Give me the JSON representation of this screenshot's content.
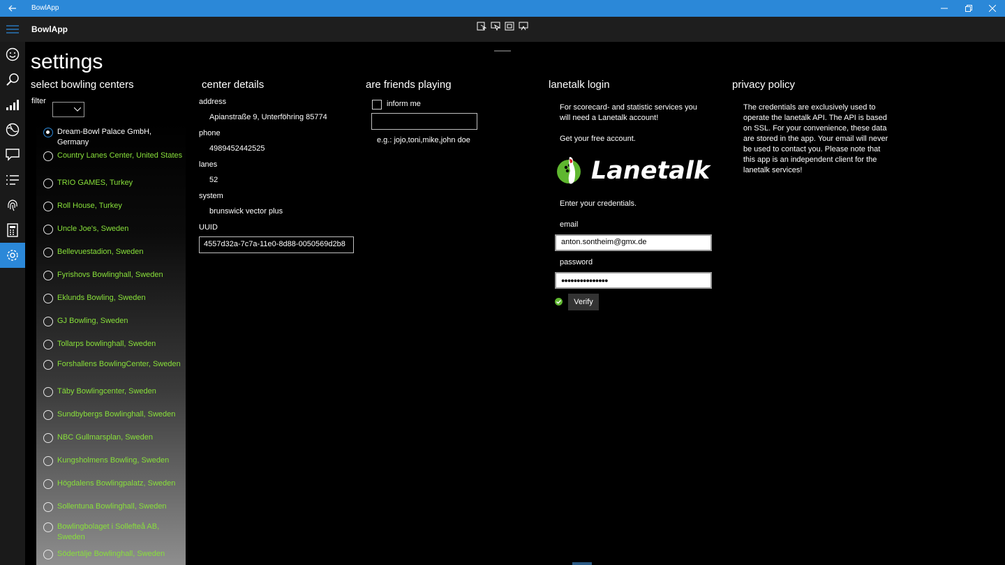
{
  "window": {
    "title": "BowlApp",
    "controls": [
      "minimize",
      "restore",
      "close"
    ]
  },
  "appbar": {
    "app_name": "BowlApp",
    "tools": [
      "tool-1-icon",
      "tool-2-icon",
      "tool-3-icon",
      "tool-4-icon"
    ]
  },
  "sidebar": {
    "items": [
      {
        "icon": "hamburger-menu-icon"
      },
      {
        "icon": "smiley-icon"
      },
      {
        "icon": "search-icon"
      },
      {
        "icon": "statistics-icon"
      },
      {
        "icon": "globe-icon"
      },
      {
        "icon": "chat-icon"
      },
      {
        "icon": "list-icon"
      },
      {
        "icon": "fingerprint-icon"
      },
      {
        "icon": "calculator-icon"
      },
      {
        "icon": "settings-icon",
        "active": true
      }
    ]
  },
  "page": {
    "heading": "settings"
  },
  "centers": {
    "title": "select bowling centers",
    "filter_label": "filter",
    "items": [
      {
        "label": "Dream-Bowl Palace GmbH, Germany",
        "selected": true
      },
      {
        "label": "Country Lanes Center, United States"
      },
      {
        "label": "TRIO GAMES, Turkey"
      },
      {
        "label": "Roll House, Turkey"
      },
      {
        "label": "Uncle Joe's, Sweden"
      },
      {
        "label": "Bellevuestadion, Sweden"
      },
      {
        "label": "Fyrishovs Bowlinghall, Sweden"
      },
      {
        "label": "Eklunds Bowling, Sweden"
      },
      {
        "label": "GJ Bowling, Sweden"
      },
      {
        "label": "Tollarps bowlinghall, Sweden"
      },
      {
        "label": "Forshallens BowlingCenter, Sweden"
      },
      {
        "label": "Täby Bowlingcenter, Sweden"
      },
      {
        "label": "Sundbybergs Bowlinghall, Sweden"
      },
      {
        "label": "NBC Gullmarsplan, Sweden"
      },
      {
        "label": "Kungsholmens Bowling, Sweden"
      },
      {
        "label": "Högdalens Bowlingpalatz, Sweden"
      },
      {
        "label": "Sollentuna Bowlinghall, Sweden"
      },
      {
        "label": "Bowlingbolaget i Sollefteå AB, Sweden"
      },
      {
        "label": "Södertälje Bowlinghall, Sweden"
      }
    ]
  },
  "details": {
    "title": "center details",
    "address_label": "address",
    "address": "Apianstraße 9, Unterföhring 85774",
    "phone_label": "phone",
    "phone": "4989452442525",
    "lanes_label": "lanes",
    "lanes": "52",
    "system_label": "system",
    "system": "brunswick vector plus",
    "uuid_label": "UUID",
    "uuid": "4557d32a-7c7a-11e0-8d88-0050569d2b8"
  },
  "friends": {
    "title": "are friends playing",
    "inform_label": "inform me",
    "inform_checked": false,
    "input_value": "",
    "hint": "e.g.: jojo,toni,mike,john doe"
  },
  "lanetalk": {
    "title": "lanetalk login",
    "intro": "For scorecard- and statistic services you will need a Lanetalk account!",
    "free_account": "Get your free account.",
    "logo_text": "Lanetalk",
    "credentials_prompt": "Enter your credentials.",
    "email_label": "email",
    "email_value": "anton.sontheim@gmx.de",
    "password_label": "password",
    "password_value": "●●●●●●●●●●●●●●●",
    "verify_label": "Verify",
    "verified": true
  },
  "privacy": {
    "title": "privacy policy",
    "text": "The credentials are exclusively used to operate the lanetalk API. The API is based on SSL. For your convenience, these data are stored in the app. Your email will never be used to contact you. Please note that this app is an independent client for the lanetalk services!"
  },
  "colors": {
    "accent": "#2b88d8",
    "link_green": "#88e03a",
    "background": "#000000"
  }
}
